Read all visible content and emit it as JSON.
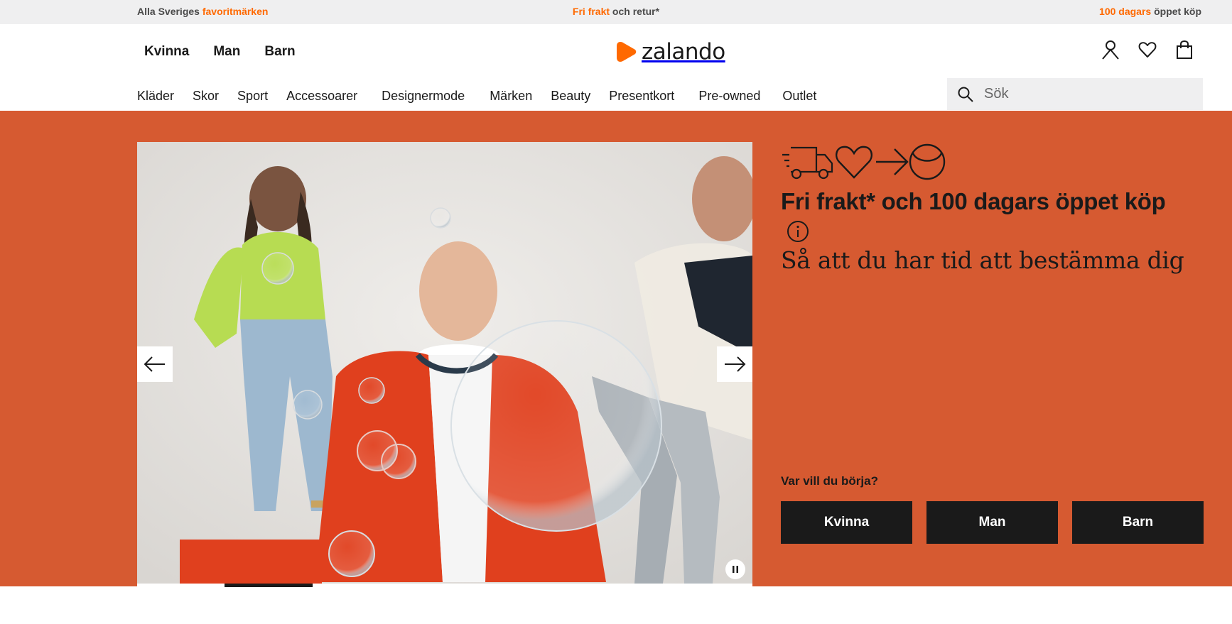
{
  "topbar": {
    "left_prefix": "Alla Sveriges ",
    "left_highlight": "favoritmärken",
    "center_highlight": "Fri frakt",
    "center_suffix": " och retur*",
    "right_highlight": "100 dagars",
    "right_suffix": " öppet köp"
  },
  "header": {
    "gender_nav": [
      "Kvinna",
      "Man",
      "Barn"
    ],
    "logo_text": "zalando",
    "icons": [
      "user-icon",
      "heart-icon",
      "bag-icon"
    ],
    "category_nav": [
      "Kläder",
      "Skor",
      "Sport",
      "Accessoarer",
      "Designermode",
      "Märken",
      "Beauty",
      "Presentkort",
      "Pre-owned",
      "Outlet"
    ],
    "search_placeholder": "Sök"
  },
  "hero": {
    "promo_icons": [
      "delivery-truck-icon",
      "heart-icon",
      "arrow-right-icon",
      "return-smile-icon"
    ],
    "headline": "Fri frakt* och 100 dagars öppet köp",
    "subheadline": "Så att du har tid att bestämma dig",
    "where_label": "Var vill du börja?",
    "cta_buttons": [
      "Kvinna",
      "Man",
      "Barn"
    ],
    "carousel_progress": 0.2857
  },
  "colors": {
    "accent_orange": "#ff6900",
    "hero_background": "#d65a31",
    "button_dark": "#1a1a1a"
  }
}
